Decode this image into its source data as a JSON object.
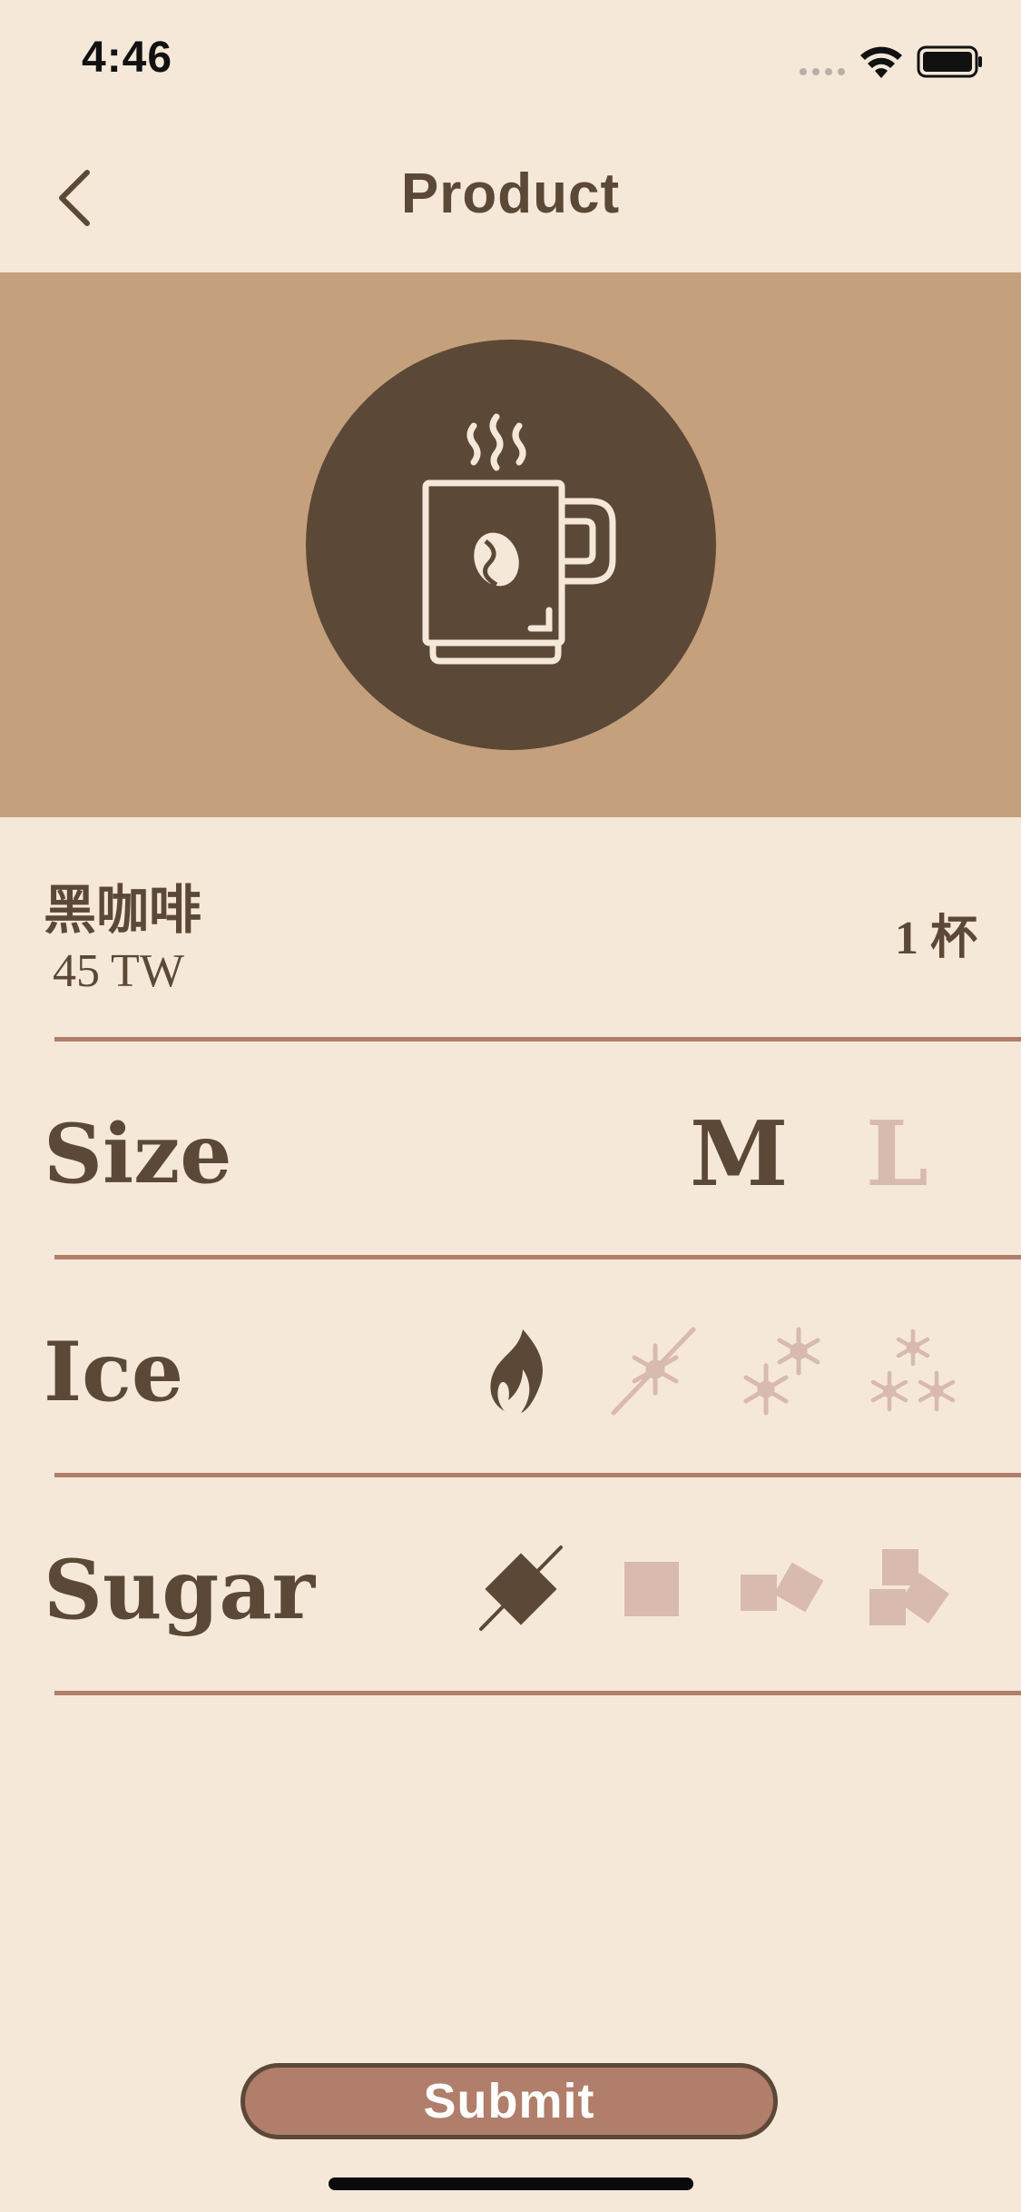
{
  "status_bar": {
    "time": "4:46",
    "signal_icon": "signal-dots-icon",
    "wifi_icon": "wifi-icon",
    "battery_icon": "battery-icon"
  },
  "nav": {
    "title": "Product",
    "back_icon": "chevron-left-icon"
  },
  "hero": {
    "icon": "coffee-mug-icon",
    "background_color": "#C4A07C",
    "circle_color": "#5C4837"
  },
  "product": {
    "name": "黑咖啡",
    "price": "45 TW",
    "quantity": "1 杯"
  },
  "size": {
    "label": "Size",
    "options": [
      "M",
      "L"
    ],
    "selected": "M"
  },
  "ice": {
    "label": "Ice",
    "options": [
      {
        "icon": "flame-icon",
        "selected": true
      },
      {
        "icon": "no-ice-icon",
        "selected": false
      },
      {
        "icon": "less-ice-icon",
        "selected": false
      },
      {
        "icon": "full-ice-icon",
        "selected": false
      }
    ]
  },
  "sugar": {
    "label": "Sugar",
    "options": [
      {
        "icon": "no-sugar-icon",
        "selected": true
      },
      {
        "icon": "one-sugar-cube-icon",
        "selected": false
      },
      {
        "icon": "two-sugar-cubes-icon",
        "selected": false
      },
      {
        "icon": "three-sugar-cubes-icon",
        "selected": false
      }
    ]
  },
  "submit": {
    "label": "Submit"
  },
  "colors": {
    "background": "#F5E8D8",
    "primary": "#5C4837",
    "accent": "#B07E6A",
    "inactive": "#D8BAAE"
  }
}
